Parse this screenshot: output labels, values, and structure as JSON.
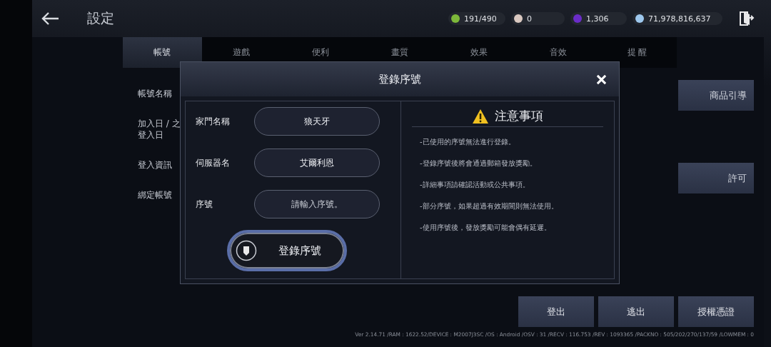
{
  "header": {
    "title": "設定",
    "currencies": [
      {
        "kind": "stamina",
        "value": "191/490"
      },
      {
        "kind": "pearl",
        "value": "0"
      },
      {
        "kind": "gem",
        "value": "1,306"
      },
      {
        "kind": "silver",
        "value": "71,978,816,637"
      }
    ]
  },
  "tabs": [
    {
      "label": "帳號",
      "selected": true
    },
    {
      "label": "遊戲",
      "selected": false
    },
    {
      "label": "便利",
      "selected": false
    },
    {
      "label": "畫質",
      "selected": false
    },
    {
      "label": "效果",
      "selected": false
    },
    {
      "label": "音效",
      "selected": false
    },
    {
      "label": "提 醒",
      "selected": false
    }
  ],
  "account_labels": [
    [
      "帳號名稱"
    ],
    [
      "加入日 / 之",
      "登入日"
    ],
    [
      "登入資訊"
    ],
    [
      "綁定帳號"
    ]
  ],
  "side_buttons": [
    "商品引導",
    "許可"
  ],
  "bottom_buttons": [
    "登出",
    "逃出",
    "授權憑證"
  ],
  "version": "Ver 2.14.71 /RAM：1622.52/DEVICE：M2007J3SC /OS：Android /OSV：31 /RECV：116.753 /REV：1093365 /PACKNO：505/202/270/137/59 /LOWMEM：0",
  "dialog": {
    "title": "登錄序號",
    "fields": [
      {
        "label": "家門名稱",
        "value": "狼天牙"
      },
      {
        "label": "伺服器名",
        "value": "艾爾利恩"
      },
      {
        "label": "序號",
        "placeholder": "請輸入序號。"
      }
    ],
    "submit": "登錄序號",
    "notice": {
      "title": "注意事項",
      "items": [
        "-已使用的序號無法進行登錄。",
        "-登錄序號後將會通過郵箱發放獎勵。",
        "-詳細事項請確認活動或公共事項。",
        "-部分序號，如果超過有效期間則無法使用。",
        "-使用序號後，發放獎勵可能會偶有延遲。"
      ]
    }
  }
}
